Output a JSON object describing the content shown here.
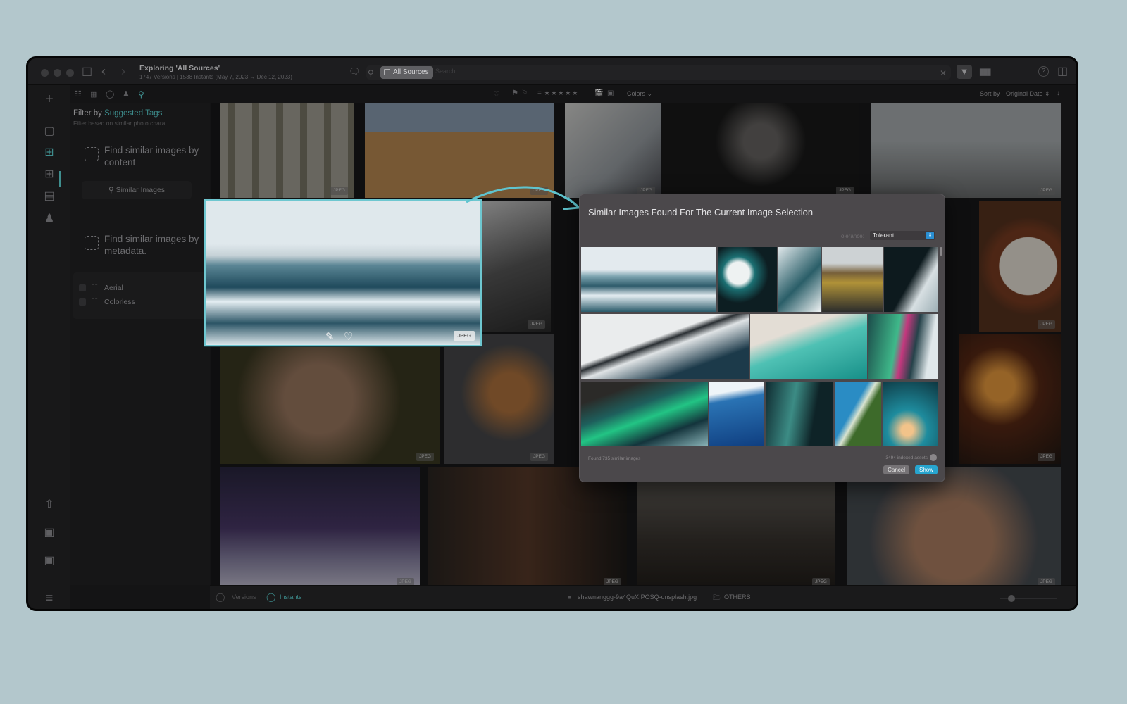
{
  "window": {
    "title": "Exploring 'All Sources'",
    "subtitle": "1747 Versions | 1538 Instants (May 7, 2023 → Dec 12, 2023)"
  },
  "search": {
    "source_label": "All Sources",
    "placeholder": "Search",
    "value": ""
  },
  "toolbar": {
    "equals": "=",
    "stars": "★★★★★",
    "colors_label": "Colors",
    "sort_label": "Sort by",
    "sort_value": "Original Date"
  },
  "panel": {
    "title_prefix": "Filter by",
    "title_accent": "Suggested Tags",
    "subtitle": "Filter based on similar photo chara…",
    "find_content": "Find similar images by content",
    "similar_button": "Similar Images",
    "find_metadata": "Find similar images by metadata.",
    "tags": [
      {
        "label": "Aerial",
        "checked": false
      },
      {
        "label": "Colorless",
        "checked": false
      }
    ]
  },
  "grid": {
    "badge": "JPEG",
    "photos": [
      "building-windows",
      "desert-car",
      "laptop-desk",
      "portrait-woman",
      "women-walking",
      "woman-dancing",
      "food-plate",
      "monkey",
      "baseball-glove",
      "grill-steak",
      "night-snow",
      "man-watch",
      "office-meeting",
      "smiling-woman"
    ]
  },
  "dialog": {
    "title": "Similar Images Found For The Current Image Selection",
    "tolerance_label": "Tolerance:",
    "tolerance_value": "Tolerant",
    "found_text": "Found 735 similar images",
    "indexed_text": "3494 indexed assets",
    "cancel_label": "Cancel",
    "show_label": "Show",
    "results": [
      "glacier-lagoon",
      "ice-floes-teal",
      "ice-aerial",
      "river-delta",
      "ice-cave",
      "winding-road",
      "turquoise-beach",
      "aurora-pink",
      "aurora-cliff",
      "whale-underwater",
      "aurora-abstract",
      "coastline-forest",
      "tent-night"
    ]
  },
  "bottom": {
    "versions_label": "Versions",
    "instants_label": "Instants",
    "filename": "shawnanggg-9a4QuXIPOSQ-unsplash.jpg",
    "folder": "OTHERS",
    "zoom_level": 0.15
  },
  "colors": {
    "accent": "#3f8e8e",
    "selection": "#6ec7d0",
    "show_button": "#27a5cf"
  }
}
